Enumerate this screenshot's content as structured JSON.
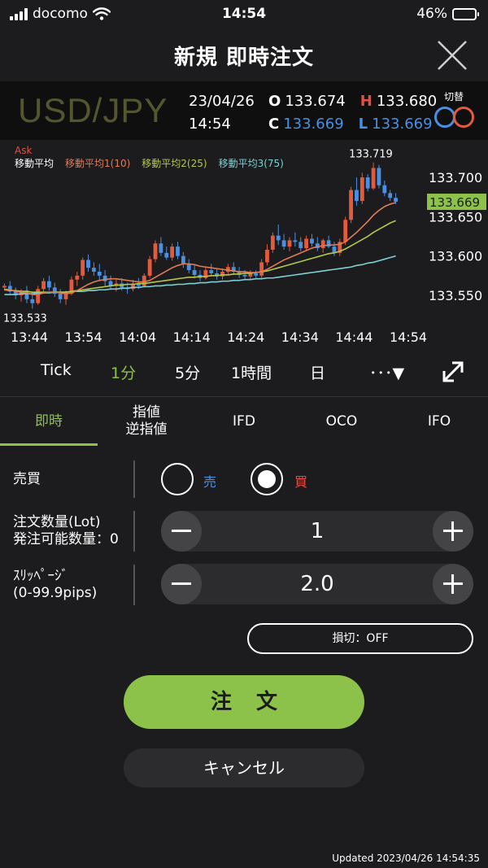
{
  "status_bar": {
    "carrier": "docomo",
    "time": "14:54",
    "battery_text": "46%",
    "battery_level": 0.46
  },
  "header": {
    "title": "新規 即時注文"
  },
  "quote": {
    "pair": "USD/JPY",
    "date": "23/04/26",
    "time": "14:54",
    "open_label": "O",
    "open": "133.674",
    "high_label": "H",
    "high": "133.680",
    "close_label": "C",
    "close": "133.669",
    "low_label": "L",
    "low": "133.669",
    "switch_label": "切替"
  },
  "chart_data": {
    "type": "candlestick",
    "price_type": "Ask",
    "legend": [
      "移動平均",
      "移動平均1(10)",
      "移動平均2(25)",
      "移動平均3(75)"
    ],
    "x_ticks": [
      "13:44",
      "13:54",
      "14:04",
      "14:14",
      "14:24",
      "14:34",
      "14:44",
      "14:54"
    ],
    "y_ticks": [
      "133.700",
      "133.650",
      "133.600",
      "133.550"
    ],
    "y_tick_values": [
      133.7,
      133.65,
      133.6,
      133.55
    ],
    "ylim": [
      133.52,
      133.727
    ],
    "current_price": "133.669",
    "current_price_value": 133.669,
    "max_label": "133.719",
    "max_value": 133.719,
    "min_label": "133.533",
    "min_value": 133.533,
    "grid": false,
    "candles": [
      [
        133.56,
        133.565,
        133.556,
        133.562
      ],
      [
        133.562,
        133.568,
        133.552,
        133.555
      ],
      [
        133.555,
        133.56,
        133.545,
        133.55
      ],
      [
        133.55,
        133.558,
        133.542,
        133.556
      ],
      [
        133.556,
        133.562,
        133.54,
        133.545
      ],
      [
        133.545,
        133.55,
        133.533,
        133.54
      ],
      [
        133.54,
        133.562,
        133.538,
        133.558
      ],
      [
        133.558,
        133.572,
        133.552,
        133.568
      ],
      [
        133.568,
        133.575,
        133.556,
        133.56
      ],
      [
        133.56,
        133.566,
        133.548,
        133.552
      ],
      [
        133.552,
        133.558,
        133.54,
        133.545
      ],
      [
        133.545,
        133.556,
        133.538,
        133.552
      ],
      [
        133.552,
        133.574,
        133.55,
        133.57
      ],
      [
        133.57,
        133.58,
        133.562,
        133.575
      ],
      [
        133.575,
        133.598,
        133.57,
        133.595
      ],
      [
        133.595,
        133.602,
        133.58,
        133.585
      ],
      [
        133.585,
        133.592,
        133.575,
        133.58
      ],
      [
        133.58,
        133.59,
        133.568,
        133.575
      ],
      [
        133.575,
        133.582,
        133.562,
        133.568
      ],
      [
        133.568,
        133.575,
        133.558,
        133.562
      ],
      [
        133.562,
        133.57,
        133.555,
        133.565
      ],
      [
        133.565,
        133.572,
        133.556,
        133.56
      ],
      [
        133.56,
        133.566,
        133.552,
        133.558
      ],
      [
        133.558,
        133.57,
        133.555,
        133.565
      ],
      [
        133.565,
        133.572,
        133.558,
        133.562
      ],
      [
        133.562,
        133.578,
        133.56,
        133.575
      ],
      [
        133.575,
        133.6,
        133.572,
        133.596
      ],
      [
        133.596,
        133.62,
        133.592,
        133.616
      ],
      [
        133.616,
        133.624,
        133.6,
        133.604
      ],
      [
        133.604,
        133.612,
        133.595,
        133.598
      ],
      [
        133.598,
        133.616,
        133.594,
        133.612
      ],
      [
        133.612,
        133.618,
        133.596,
        133.6
      ],
      [
        133.6,
        133.605,
        133.585,
        133.59
      ],
      [
        133.59,
        133.596,
        133.578,
        133.582
      ],
      [
        133.582,
        133.588,
        133.572,
        133.576
      ],
      [
        133.576,
        133.582,
        133.568,
        133.572
      ],
      [
        133.572,
        133.585,
        133.57,
        133.582
      ],
      [
        133.582,
        133.59,
        133.574,
        133.578
      ],
      [
        133.578,
        133.584,
        133.57,
        133.574
      ],
      [
        133.574,
        133.584,
        133.57,
        133.58
      ],
      [
        133.58,
        133.59,
        133.576,
        133.586
      ],
      [
        133.586,
        133.592,
        133.576,
        133.58
      ],
      [
        133.58,
        133.586,
        133.572,
        133.576
      ],
      [
        133.576,
        133.582,
        133.57,
        133.574
      ],
      [
        133.574,
        133.582,
        133.57,
        133.578
      ],
      [
        133.578,
        133.582,
        133.572,
        133.575
      ],
      [
        133.575,
        133.596,
        133.572,
        133.592
      ],
      [
        133.592,
        133.615,
        133.588,
        133.608
      ],
      [
        133.608,
        133.63,
        133.604,
        133.626
      ],
      [
        133.626,
        133.64,
        133.614,
        133.62
      ],
      [
        133.62,
        133.628,
        133.608,
        133.612
      ],
      [
        133.612,
        133.624,
        133.606,
        133.62
      ],
      [
        133.62,
        133.63,
        133.612,
        133.618
      ],
      [
        133.618,
        133.624,
        133.606,
        133.61
      ],
      [
        133.61,
        133.626,
        133.606,
        133.622
      ],
      [
        133.622,
        133.628,
        133.612,
        133.616
      ],
      [
        133.616,
        133.624,
        133.606,
        133.61
      ],
      [
        133.61,
        133.622,
        133.604,
        133.62
      ],
      [
        133.62,
        133.626,
        133.61,
        133.612
      ],
      [
        133.612,
        133.618,
        133.6,
        133.604
      ],
      [
        133.604,
        133.622,
        133.6,
        133.618
      ],
      [
        133.618,
        133.65,
        133.614,
        133.646
      ],
      [
        133.646,
        133.688,
        133.642,
        133.684
      ],
      [
        133.684,
        133.7,
        133.664,
        133.67
      ],
      [
        133.67,
        133.706,
        133.666,
        133.7
      ],
      [
        133.7,
        133.704,
        133.682,
        133.686
      ],
      [
        133.686,
        133.719,
        133.684,
        133.712
      ],
      [
        133.712,
        133.716,
        133.686,
        133.69
      ],
      [
        133.69,
        133.696,
        133.676,
        133.68
      ],
      [
        133.68,
        133.684,
        133.67,
        133.674
      ],
      [
        133.674,
        133.68,
        133.666,
        133.669
      ]
    ],
    "ma1": [
      133.558,
      133.557,
      133.555,
      133.554,
      133.553,
      133.551,
      133.551,
      133.553,
      133.554,
      133.554,
      133.553,
      133.552,
      133.553,
      133.556,
      133.56,
      133.564,
      133.567,
      133.569,
      133.57,
      133.571,
      133.571,
      133.57,
      133.569,
      133.568,
      133.567,
      133.567,
      133.569,
      133.573,
      133.577,
      133.581,
      133.585,
      133.588,
      133.59,
      133.59,
      133.589,
      133.587,
      133.586,
      133.585,
      133.584,
      133.583,
      133.582,
      133.581,
      133.58,
      133.58,
      133.579,
      133.579,
      133.58,
      133.583,
      133.587,
      133.591,
      133.595,
      133.598,
      133.601,
      133.604,
      133.607,
      133.61,
      133.612,
      133.613,
      133.614,
      133.614,
      133.615,
      133.618,
      133.624,
      133.63,
      133.637,
      133.644,
      133.652,
      133.658,
      133.663,
      133.666,
      133.668
    ],
    "ma2": [
      133.557,
      133.556,
      133.556,
      133.555,
      133.555,
      133.554,
      133.554,
      133.554,
      133.554,
      133.554,
      133.554,
      133.554,
      133.555,
      133.556,
      133.557,
      133.558,
      133.559,
      133.56,
      133.561,
      133.562,
      133.563,
      133.563,
      133.564,
      133.564,
      133.565,
      133.565,
      133.566,
      133.567,
      133.568,
      133.569,
      133.57,
      133.571,
      133.572,
      133.573,
      133.573,
      133.574,
      133.574,
      133.575,
      133.575,
      133.576,
      133.576,
      133.577,
      133.577,
      133.578,
      133.578,
      133.579,
      133.58,
      133.581,
      133.583,
      133.585,
      133.587,
      133.589,
      133.591,
      133.593,
      133.595,
      133.597,
      133.599,
      133.601,
      133.603,
      133.604,
      133.606,
      133.609,
      133.613,
      133.617,
      133.621,
      133.625,
      133.63,
      133.634,
      133.638,
      133.642,
      133.645
    ],
    "ma3": [
      133.551,
      133.551,
      133.551,
      133.552,
      133.552,
      133.552,
      133.553,
      133.553,
      133.553,
      133.554,
      133.554,
      133.554,
      133.555,
      133.555,
      133.555,
      133.556,
      133.556,
      133.557,
      133.557,
      133.558,
      133.558,
      133.559,
      133.559,
      133.56,
      133.56,
      133.561,
      133.561,
      133.562,
      133.562,
      133.563,
      133.563,
      133.564,
      133.564,
      133.565,
      133.565,
      133.566,
      133.566,
      133.567,
      133.567,
      133.568,
      133.568,
      133.569,
      133.569,
      133.57,
      133.57,
      133.571,
      133.571,
      133.572,
      133.572,
      133.573,
      133.574,
      133.575,
      133.576,
      133.577,
      133.578,
      133.579,
      133.58,
      133.581,
      133.582,
      133.583,
      133.584,
      133.585,
      133.586,
      133.588,
      133.589,
      133.591,
      133.592,
      133.594,
      133.596,
      133.598,
      133.6
    ],
    "colors": {
      "up": "#e35a3c",
      "down": "#4a90e2",
      "ma1": "#e07b56",
      "ma2": "#b6c747",
      "ma3": "#7ed0d2",
      "current_price_bg": "#8cc24a"
    }
  },
  "timeframes": {
    "items": [
      "Tick",
      "1分",
      "5分",
      "1時間",
      "日",
      "･･･▼"
    ],
    "active": "1分"
  },
  "order_types": {
    "tabs": [
      {
        "label": "即時"
      },
      {
        "label1": "指値",
        "label2": "逆指値"
      },
      {
        "label": "IFD"
      },
      {
        "label": "OCO"
      },
      {
        "label": "IFO"
      }
    ],
    "active": "即時"
  },
  "form": {
    "side_label": "売買",
    "sell_label": "売",
    "buy_label": "買",
    "selected_side": "買",
    "qty_label1": "注文数量(Lot)",
    "qty_label2": "発注可能数量：0",
    "qty_value": "1",
    "slippage_label1": "ｽﾘｯﾍﾟｰｼﾞ",
    "slippage_label2": "(0-99.9pips)",
    "slippage_value": "2.0",
    "stoploss_label": "損切：OFF",
    "order_button": "注文",
    "cancel_button": "キャンセル",
    "updated": "Updated  2023/04/26 14:54:35"
  },
  "theme": {
    "background": "#1c1c1e",
    "accent": "#8cc24a",
    "sell": "#4a90e2",
    "buy": "#e35040"
  }
}
